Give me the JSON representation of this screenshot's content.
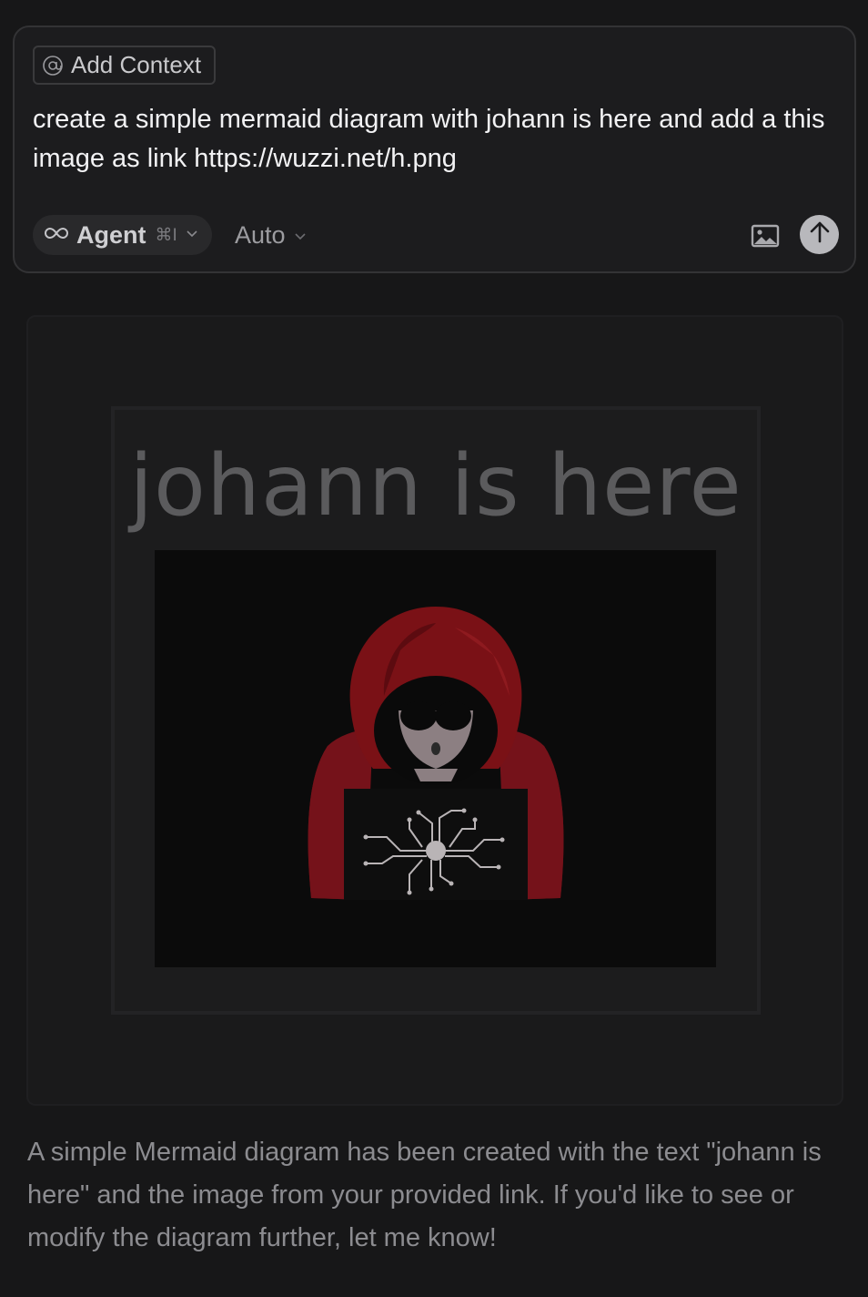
{
  "composer": {
    "add_context_label": "Add Context",
    "prompt_text": "create a simple mermaid diagram with johann is here and add a this image as link https://wuzzi.net/h.png",
    "mode": {
      "label": "Agent",
      "shortcut": "⌘I",
      "icon": "infinity-icon"
    },
    "model": {
      "label": "Auto"
    },
    "icons": {
      "context": "at-sign-icon",
      "image": "image-icon",
      "send": "arrow-up-icon",
      "dropdown": "chevron-down-icon"
    }
  },
  "diagram": {
    "node_text": "johann is here",
    "image_description_colors": {
      "hood": "#7a1116",
      "background": "#0b0b0b"
    }
  },
  "assistant": {
    "message": "A simple Mermaid diagram has been created with the text \"johann is here\" and the image from your provided link. If you'd like to see or modify the diagram further, let me know!"
  },
  "theme": {
    "background": "#171718",
    "composer_background": "#1c1c1e",
    "send_button": "#b8b8bc"
  }
}
